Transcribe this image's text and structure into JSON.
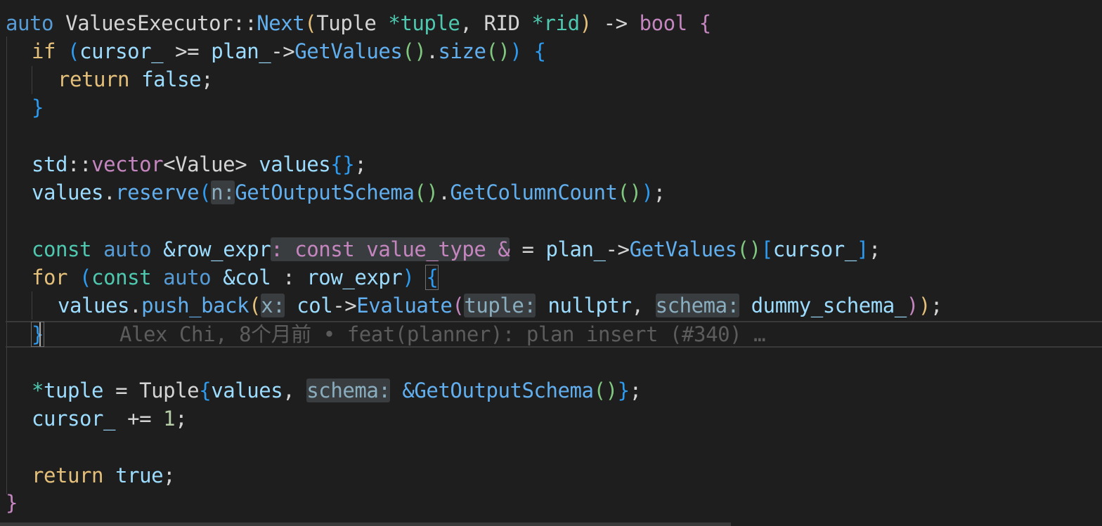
{
  "code": {
    "l1": {
      "auto": "auto",
      "cls": "ValuesExecutor",
      "sep": "::",
      "fn": "Next",
      "open": "(",
      "t1": "Tuple",
      "star1": "*",
      "p1": "tuple",
      "comma": ",",
      "t2": "RID",
      "star2": "*",
      "p2": "rid",
      "close": ")",
      "arrow": "->",
      "ret": "bool",
      "brace": "{"
    },
    "l2": {
      "kw": "if",
      "open": "(",
      "a": "cursor_",
      "op": ">=",
      "b": "plan_",
      "arrow": "->",
      "fn": "GetValues",
      "call": "()",
      "dot": ".",
      "fn2": "size",
      "call2": "()",
      "close": ")",
      "brace": "{"
    },
    "l3": {
      "kw": "return",
      "val": "false",
      "semi": ";"
    },
    "l4": {
      "brace": "}"
    },
    "l6": {
      "ns": "std",
      "sep": "::",
      "tpl": "vector",
      "lt": "<",
      "t": "Value",
      "gt": ">",
      "name": "values",
      "init": "{}",
      "semi": ";"
    },
    "l7": {
      "obj": "values",
      "dot": ".",
      "fn": "reserve",
      "open": "(",
      "hint": "n:",
      "fn2": "GetOutputSchema",
      "call": "()",
      "dot2": ".",
      "fn3": "GetColumnCount",
      "call2": "()",
      "close": ")",
      "semi": ";"
    },
    "l9": {
      "const": "const",
      "auto": "auto",
      "ref": "&row_expr",
      "hint": ": const value_type &",
      "eq": "=",
      "obj": "plan_",
      "arrow": "->",
      "fn": "GetValues",
      "call": "()",
      "lb": "[",
      "idx": "cursor_",
      "rb": "]",
      "semi": ";"
    },
    "l10": {
      "kw": "for",
      "open": "(",
      "const": "const",
      "auto": "auto",
      "ref": "&col",
      "colon": ":",
      "range": "row_expr",
      "close": ")",
      "brace": "{"
    },
    "l11": {
      "obj": "values",
      "dot": ".",
      "fn": "push_back",
      "open": "(",
      "hint1": "x:",
      "col": "col",
      "arrow": "->",
      "fn2": "Evaluate",
      "open2": "(",
      "hint2": "tuple:",
      "arg1": "nullptr",
      "comma": ",",
      "hint3": "schema:",
      "arg2": "dummy_schema_",
      "close2": ")",
      "close": ")",
      "semi": ";"
    },
    "l12": {
      "brace": "}",
      "blame": "Alex Chi, 8个月前 • feat(planner): plan insert (#340) …"
    },
    "l14": {
      "star": "*",
      "name": "tuple",
      "eq": "=",
      "t": "Tuple",
      "lb": "{",
      "arg1": "values",
      "comma": ",",
      "hint": "schema:",
      "amp": "&",
      "fn": "GetOutputSchema",
      "call": "()",
      "rb": "}",
      "semi": ";"
    },
    "l15": {
      "name": "cursor_",
      "op": "+=",
      "num": "1",
      "semi": ";"
    },
    "l17": {
      "kw": "return",
      "val": "true",
      "semi": ";"
    },
    "l18": {
      "brace": "}"
    }
  },
  "colors": {
    "background": "#1e1e1e",
    "keyword": "#569cd6",
    "control": "#c586c0",
    "function": "#61afef",
    "variable": "#9cdcfe",
    "type": "#4ec9b0",
    "return_keyword": "#e5c07b",
    "inlay_hint_bg": "#3a3d3f"
  }
}
